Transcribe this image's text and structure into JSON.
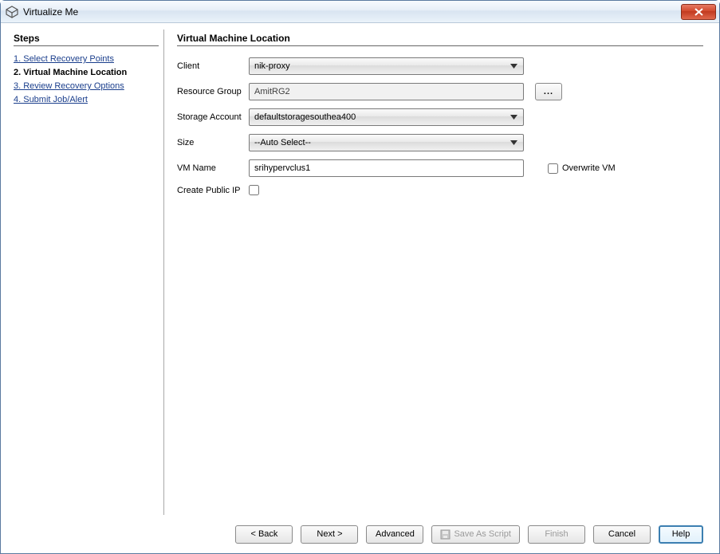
{
  "window": {
    "title": "Virtualize Me"
  },
  "sidebar": {
    "heading": "Steps",
    "items": [
      {
        "label": "1. Select Recovery Points",
        "current": false
      },
      {
        "label": "2. Virtual Machine Location",
        "current": true
      },
      {
        "label": "3. Review Recovery Options",
        "current": false
      },
      {
        "label": "4. Submit Job/Alert",
        "current": false
      }
    ]
  },
  "main": {
    "heading": "Virtual Machine Location",
    "fields": {
      "client": {
        "label": "Client",
        "value": "nik-proxy"
      },
      "resource_group": {
        "label": "Resource Group",
        "value": "AmitRG2",
        "browse": "..."
      },
      "storage_account": {
        "label": "Storage Account",
        "value": "defaultstoragesouthea400"
      },
      "size": {
        "label": "Size",
        "value": "--Auto Select--"
      },
      "vm_name": {
        "label": "VM Name",
        "value": "srihypervclus1"
      },
      "overwrite_vm": {
        "label": "Overwrite VM",
        "checked": false
      },
      "create_public_ip": {
        "label": "Create Public IP",
        "checked": false
      }
    }
  },
  "footer": {
    "back": "< Back",
    "next": "Next >",
    "advanced": "Advanced",
    "save_as_script": "Save As Script",
    "finish": "Finish",
    "cancel": "Cancel",
    "help": "Help"
  }
}
